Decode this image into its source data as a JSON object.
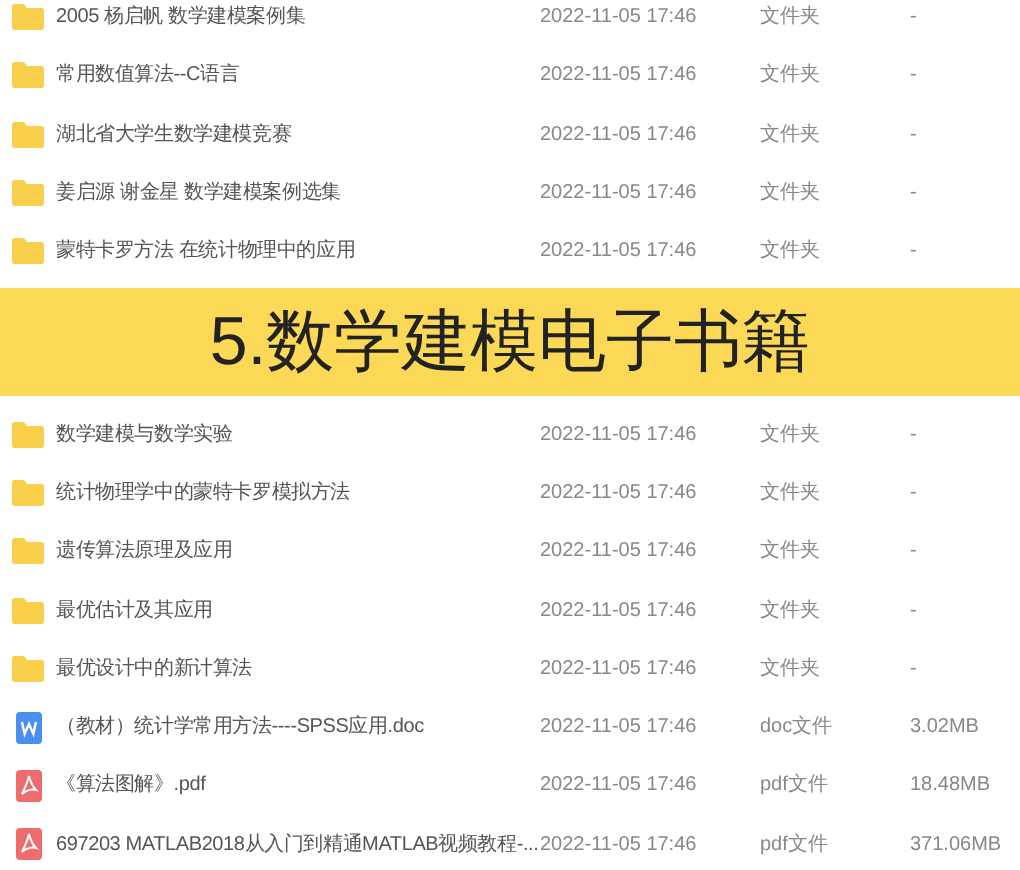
{
  "files_top": [
    {
      "kind": "folder",
      "name": "2005 杨启帆 数学建模案例集",
      "modified": "2022-11-05 17:46",
      "type": "文件夹",
      "size": "-"
    },
    {
      "kind": "folder",
      "name": "常用数值算法--C语言",
      "modified": "2022-11-05 17:46",
      "type": "文件夹",
      "size": "-"
    },
    {
      "kind": "folder",
      "name": "湖北省大学生数学建模竞赛",
      "modified": "2022-11-05 17:46",
      "type": "文件夹",
      "size": "-"
    },
    {
      "kind": "folder",
      "name": "姜启源 谢金星 数学建模案例选集",
      "modified": "2022-11-05 17:46",
      "type": "文件夹",
      "size": "-"
    },
    {
      "kind": "folder",
      "name": "蒙特卡罗方法 在统计物理中的应用",
      "modified": "2022-11-05 17:46",
      "type": "文件夹",
      "size": "-"
    }
  ],
  "banner": {
    "title": "5.数学建模电子书籍"
  },
  "files_bottom": [
    {
      "kind": "folder",
      "name": "数学建模与数学实验",
      "modified": "2022-11-05 17:46",
      "type": "文件夹",
      "size": "-"
    },
    {
      "kind": "folder",
      "name": "统计物理学中的蒙特卡罗模拟方法",
      "modified": "2022-11-05 17:46",
      "type": "文件夹",
      "size": "-"
    },
    {
      "kind": "folder",
      "name": "遗传算法原理及应用",
      "modified": "2022-11-05 17:46",
      "type": "文件夹",
      "size": "-"
    },
    {
      "kind": "folder",
      "name": "最优估计及其应用",
      "modified": "2022-11-05 17:46",
      "type": "文件夹",
      "size": "-"
    },
    {
      "kind": "folder",
      "name": "最优设计中的新计算法",
      "modified": "2022-11-05 17:46",
      "type": "文件夹",
      "size": "-"
    },
    {
      "kind": "doc",
      "name": "（教材）统计学常用方法----SPSS应用.doc",
      "modified": "2022-11-05 17:46",
      "type": "doc文件",
      "size": "3.02MB"
    },
    {
      "kind": "pdf",
      "name": "《算法图解》.pdf",
      "modified": "2022-11-05 17:46",
      "type": "pdf文件",
      "size": "18.48MB"
    },
    {
      "kind": "pdf",
      "name": "697203 MATLAB2018从入门到精通MATLAB视频教程-...",
      "modified": "2022-11-05 17:46",
      "type": "pdf文件",
      "size": "371.06MB"
    }
  ]
}
